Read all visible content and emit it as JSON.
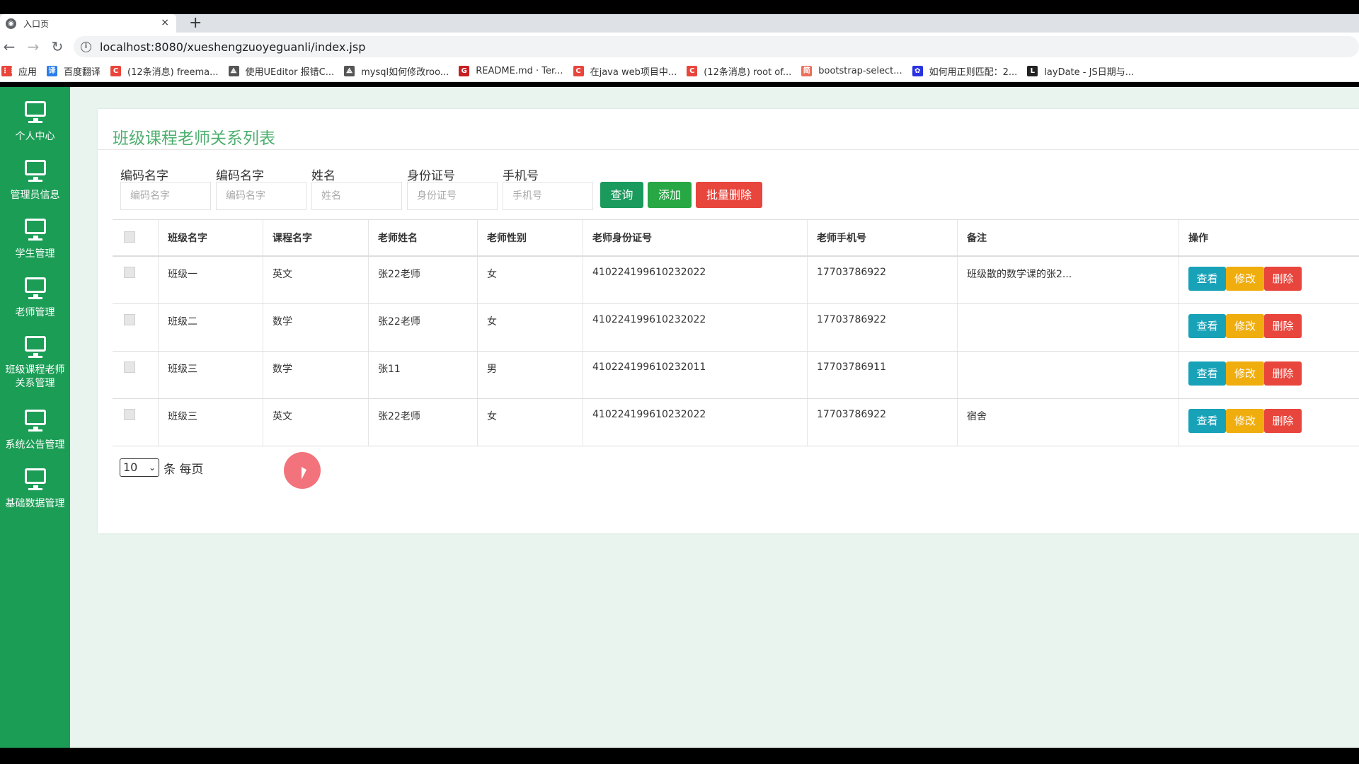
{
  "browser": {
    "tab_title": "入口页",
    "tab_close": "×",
    "new_tab": "+",
    "url": "localhost:8080/xueshengzuoyeguanli/index.jsp",
    "bookmarks": [
      {
        "label": "应用",
        "icon": "apps-grid-icon",
        "color": "#e8453c"
      },
      {
        "label": "百度翻译",
        "icon": "baidu-translate-icon",
        "color": "#2b7de9"
      },
      {
        "label": "(12条消息) freema...",
        "icon": "csdn-icon",
        "color": "#e8453c"
      },
      {
        "label": "使用UEditor 报错C...",
        "icon": "ueditor-icon",
        "color": "#555555"
      },
      {
        "label": "mysql如何修改roo...",
        "icon": "ueditor-icon",
        "color": "#555555"
      },
      {
        "label": "README.md · Ter...",
        "icon": "gitee-icon",
        "color": "#c71d23"
      },
      {
        "label": "在java web项目中...",
        "icon": "csdn-icon",
        "color": "#e8453c"
      },
      {
        "label": "(12条消息) root of...",
        "icon": "csdn-icon",
        "color": "#e8453c"
      },
      {
        "label": "bootstrap-select...",
        "icon": "jianshu-icon",
        "color": "#ea6f5a"
      },
      {
        "label": "如何用正则匹配：2...",
        "icon": "baidu-paw-icon",
        "color": "#2932e1"
      },
      {
        "label": "layDate - JS日期与...",
        "icon": "layui-icon",
        "color": "#222222"
      }
    ]
  },
  "sidebar": {
    "items": [
      {
        "label": "个人中心"
      },
      {
        "label": "管理员信息"
      },
      {
        "label": "学生管理"
      },
      {
        "label": "老师管理"
      },
      {
        "label": "班级课程老师关系管理"
      },
      {
        "label": "系统公告管理"
      },
      {
        "label": "基础数据管理"
      }
    ]
  },
  "main": {
    "title": "班级课程老师关系列表",
    "filters": [
      {
        "label": "编码名字",
        "placeholder": "编码名字"
      },
      {
        "label": "编码名字",
        "placeholder": "编码名字"
      },
      {
        "label": "姓名",
        "placeholder": "姓名"
      },
      {
        "label": "身份证号",
        "placeholder": "身份证号"
      },
      {
        "label": "手机号",
        "placeholder": "手机号"
      }
    ],
    "buttons": {
      "query": "查询",
      "add": "添加",
      "batch_delete": "批量删除"
    },
    "colors": {
      "query": "#1a9a5c",
      "add": "#28a745",
      "batch_delete": "#e8453c",
      "view": "#17a2b8",
      "edit": "#f0ad0e",
      "delete": "#e8453c"
    },
    "table": {
      "headers": [
        "班级名字",
        "课程名字",
        "老师姓名",
        "老师性别",
        "老师身份证号",
        "老师手机号",
        "备注",
        "操作"
      ],
      "rows": [
        [
          "班级一",
          "英文",
          "张22老师",
          "女",
          "410224199610232022",
          "17703786922",
          "班级散的数学课的张2..."
        ],
        [
          "班级二",
          "数学",
          "张22老师",
          "女",
          "410224199610232022",
          "17703786922",
          ""
        ],
        [
          "班级三",
          "数学",
          "张11",
          "男",
          "410224199610232011",
          "17703786911",
          ""
        ],
        [
          "班级三",
          "英文",
          "张22老师",
          "女",
          "410224199610232022",
          "17703786922",
          "宿舍"
        ]
      ],
      "actions": {
        "view": "查看",
        "edit": "修改",
        "delete": "删除"
      }
    },
    "pager": {
      "page_size": "10",
      "suffix": "条 每页"
    }
  }
}
